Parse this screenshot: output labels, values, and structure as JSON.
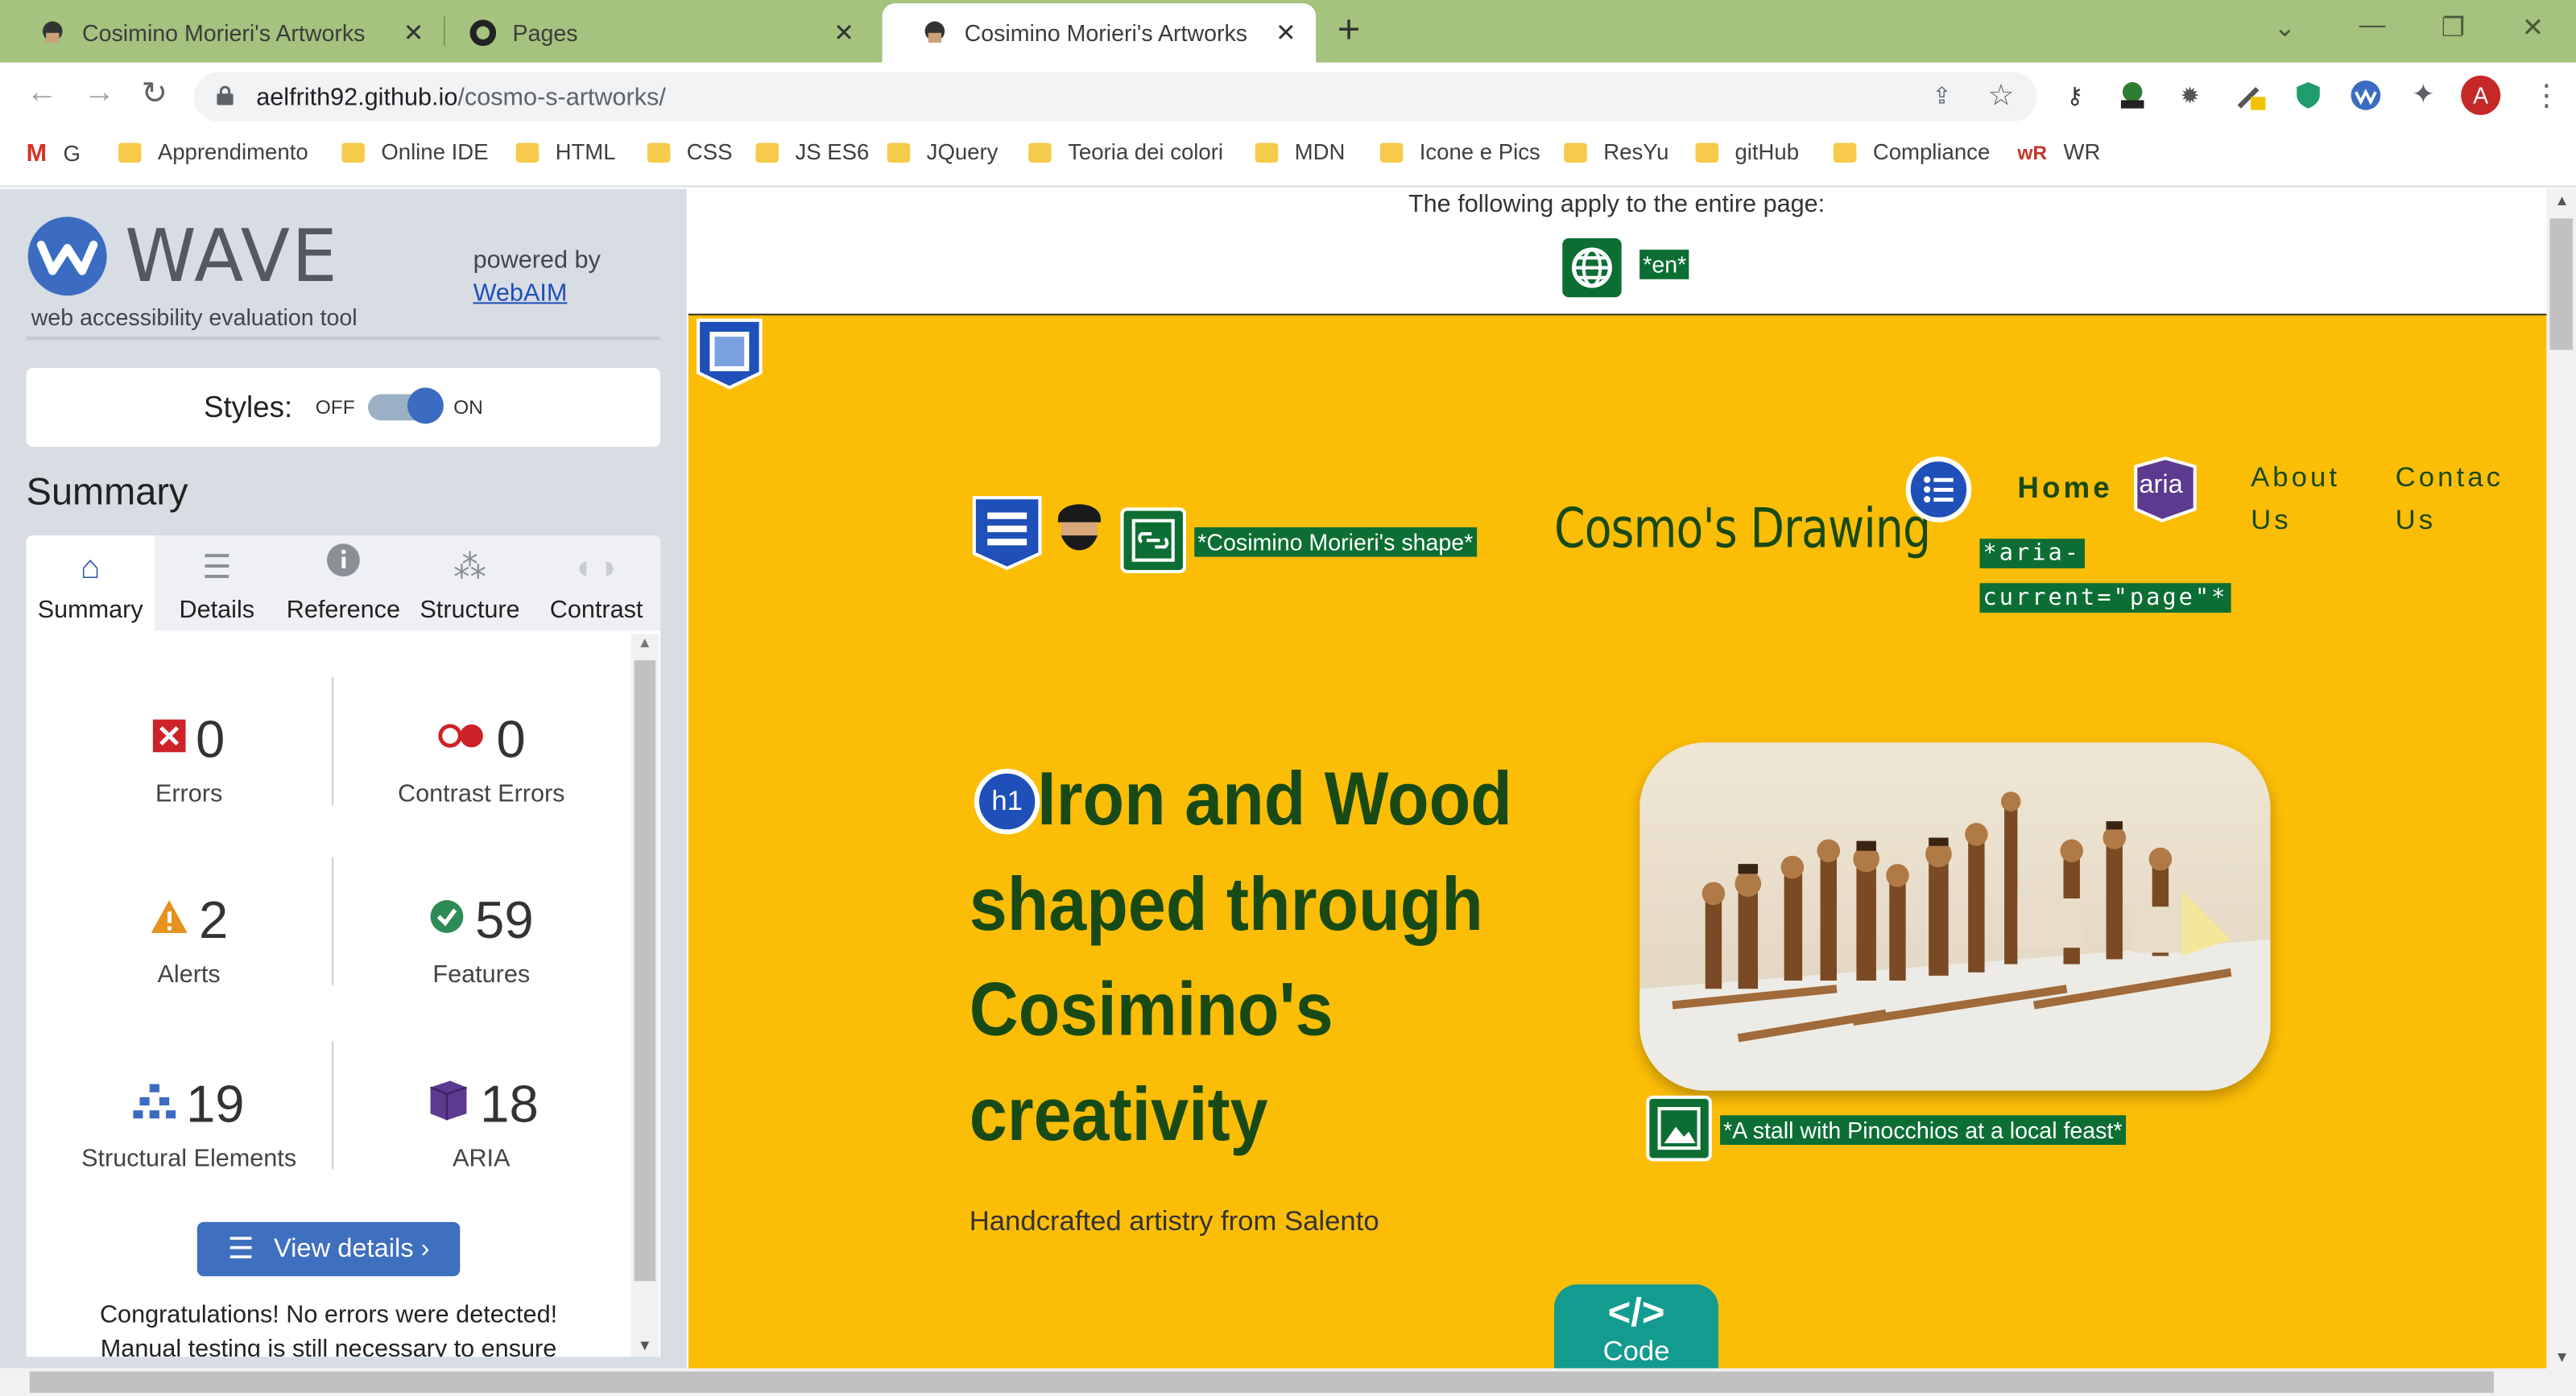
{
  "browser": {
    "tabs": [
      {
        "title": "Cosimino Morieri's Artworks",
        "active": false
      },
      {
        "title": "Pages",
        "active": false
      },
      {
        "title": "Cosimino Morieri's Artworks",
        "active": true
      }
    ],
    "url_domain": "aelfrith92.github.io",
    "url_path": "/cosmo-s-artworks/",
    "profile_initial": "A",
    "bookmarks": [
      "G",
      "Apprendimento",
      "Online IDE",
      "HTML",
      "CSS",
      "JS ES6",
      "JQuery",
      "Teoria dei colori",
      "MDN",
      "Icone e Pics",
      "ResYu",
      "gitHub",
      "Compliance",
      "WR"
    ]
  },
  "wave": {
    "title": "WAVE",
    "subtitle": "web accessibility evaluation tool",
    "powered_by": "powered by",
    "webaim": "WebAIM",
    "styles_label": "Styles:",
    "off": "OFF",
    "on": "ON",
    "summary_heading": "Summary",
    "tabs": [
      "Summary",
      "Details",
      "Reference",
      "Structure",
      "Contrast"
    ],
    "stats": {
      "errors": {
        "value": "0",
        "label": "Errors"
      },
      "contrast_errors": {
        "value": "0",
        "label": "Contrast Errors"
      },
      "alerts": {
        "value": "2",
        "label": "Alerts"
      },
      "features": {
        "value": "59",
        "label": "Features"
      },
      "structural": {
        "value": "19",
        "label": "Structural Elements"
      },
      "aria": {
        "value": "18",
        "label": "ARIA"
      }
    },
    "view_details": "View details ›",
    "congrats_1": "Congratulations! No errors were detected!",
    "congrats_2": "Manual testing is still necessary to ensure"
  },
  "page": {
    "apply_text": "The following apply to the entire page:",
    "lang_label": "*en*",
    "logo_alt": "*Cosimino Morieri's shape*",
    "brand": "Cosmo's Drawing",
    "nav_home": "Home",
    "aria_badge": "aria",
    "aria_current_1": "*aria-",
    "aria_current_2": "current=\"page\"*",
    "nav_about": "About\nUs",
    "nav_contact": "Contac\nUs",
    "h1_badge": "h1",
    "hero_title": "Iron and Wood shaped through Cosimino's creativity",
    "hero_sub": "Handcrafted artistry from Salento",
    "photo_alt": "*A stall with Pinocchios at a local feast*",
    "code_label": "Code",
    "code_icon": "</>"
  },
  "colors": {
    "page_bg": "#fcbd06",
    "text_green": "#174a15",
    "wave_label_green": "#0d6e34",
    "wave_blue": "#3f6fbf"
  }
}
